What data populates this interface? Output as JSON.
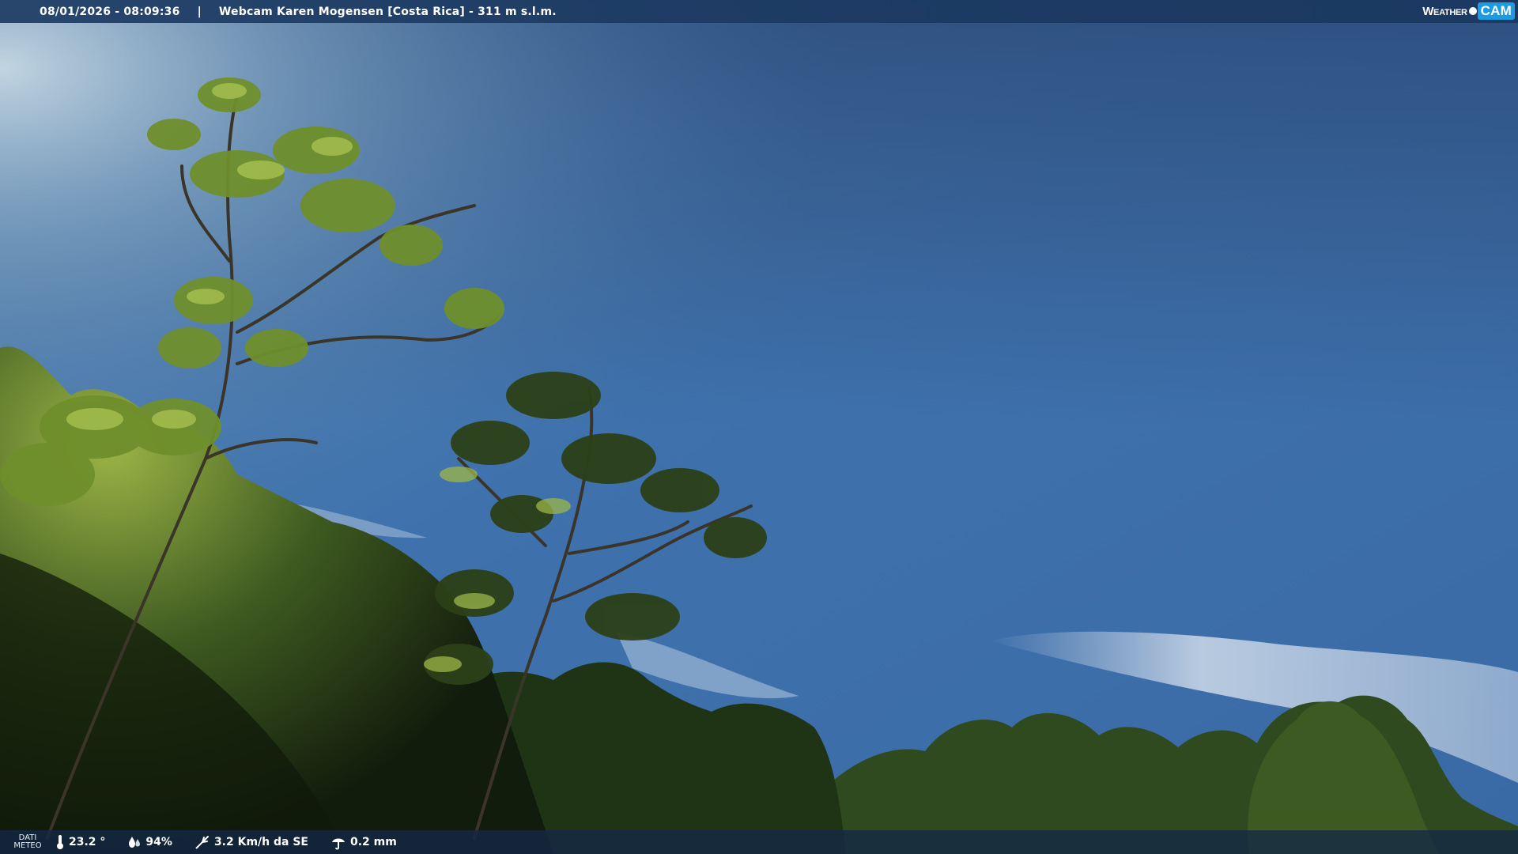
{
  "header": {
    "timestamp": "08/01/2026 - 08:09:36",
    "separator": "|",
    "camera_title": "Webcam Karen Mogensen [Costa Rica]  - 311 m s.l.m."
  },
  "brand": {
    "weather": "Weather",
    "cam": "CAM",
    "accent_color": "#1c9be0"
  },
  "footer": {
    "dati_line1": "DATI",
    "dati_line2": "METEO",
    "temperature": "23.2 °",
    "humidity": "94%",
    "wind": "3.2 Km/h da SE",
    "rain": "0.2 mm",
    "icons": [
      "thermometer-icon",
      "humidity-drops-icon",
      "wind-icon",
      "rain-icon"
    ]
  },
  "scene": {
    "sky_top_color": "#2b4a78",
    "sky_mid_color": "#3f72ad",
    "sky_glow_color": "#a9c6da",
    "foliage_dark_color": "#16230f",
    "foliage_light_color": "#8fae3c"
  }
}
